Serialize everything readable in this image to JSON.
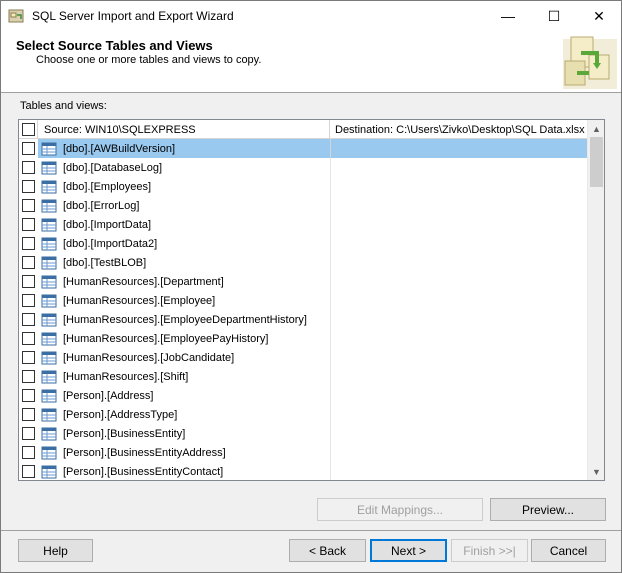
{
  "window": {
    "title": "SQL Server Import and Export Wizard",
    "minimize_glyph": "—",
    "maximize_glyph": "☐",
    "close_glyph": "✕"
  },
  "header": {
    "title": "Select Source Tables and Views",
    "subtitle": "Choose one or more tables and views to copy."
  },
  "section_label": "Tables and views:",
  "grid": {
    "columns": {
      "source": "Source: WIN10\\SQLEXPRESS",
      "destination": "Destination: C:\\Users\\Zivko\\Desktop\\SQL Data.xlsx"
    },
    "rows": [
      {
        "label": "[dbo].[AWBuildVersion]",
        "selected": true
      },
      {
        "label": "[dbo].[DatabaseLog]",
        "selected": false
      },
      {
        "label": "[dbo].[Employees]",
        "selected": false
      },
      {
        "label": "[dbo].[ErrorLog]",
        "selected": false
      },
      {
        "label": "[dbo].[ImportData]",
        "selected": false
      },
      {
        "label": "[dbo].[ImportData2]",
        "selected": false
      },
      {
        "label": "[dbo].[TestBLOB]",
        "selected": false
      },
      {
        "label": "[HumanResources].[Department]",
        "selected": false
      },
      {
        "label": "[HumanResources].[Employee]",
        "selected": false
      },
      {
        "label": "[HumanResources].[EmployeeDepartmentHistory]",
        "selected": false
      },
      {
        "label": "[HumanResources].[EmployeePayHistory]",
        "selected": false
      },
      {
        "label": "[HumanResources].[JobCandidate]",
        "selected": false
      },
      {
        "label": "[HumanResources].[Shift]",
        "selected": false
      },
      {
        "label": "[Person].[Address]",
        "selected": false
      },
      {
        "label": "[Person].[AddressType]",
        "selected": false
      },
      {
        "label": "[Person].[BusinessEntity]",
        "selected": false
      },
      {
        "label": "[Person].[BusinessEntityAddress]",
        "selected": false
      },
      {
        "label": "[Person].[BusinessEntityContact]",
        "selected": false
      }
    ]
  },
  "buttons": {
    "edit_mappings": "Edit Mappings...",
    "preview": "Preview...",
    "help": "Help",
    "back": "< Back",
    "next": "Next >",
    "finish": "Finish >>|",
    "cancel": "Cancel"
  },
  "colors": {
    "selection": "#99c9ef",
    "default_button_border": "#0078d7"
  }
}
